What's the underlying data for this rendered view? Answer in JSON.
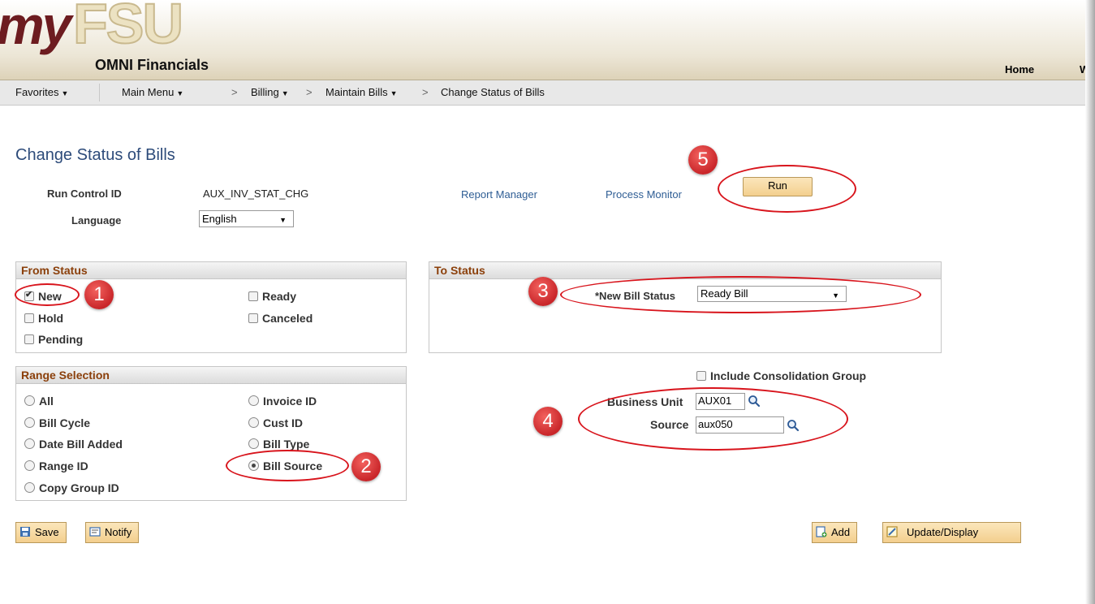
{
  "header": {
    "logo_my": "my",
    "logo_fsu": "FSU",
    "app_name": "OMNI Financials",
    "home": "Home",
    "w": "W"
  },
  "nav": {
    "favorites": "Favorites",
    "main_menu": "Main Menu",
    "billing": "Billing",
    "maintain_bills": "Maintain Bills",
    "current": "Change Status of Bills",
    "sep_symbol": ">"
  },
  "page": {
    "title": "Change Status of Bills",
    "run_control_label": "Run Control ID",
    "run_control_value": "AUX_INV_STAT_CHG",
    "language_label": "Language",
    "language_value": "English",
    "report_manager": "Report Manager",
    "process_monitor": "Process Monitor",
    "run_button": "Run"
  },
  "from_status": {
    "header": "From Status",
    "options": [
      {
        "label": "New",
        "checked": true
      },
      {
        "label": "Ready",
        "checked": false
      },
      {
        "label": "Hold",
        "checked": false
      },
      {
        "label": "Canceled",
        "checked": false
      },
      {
        "label": "Pending",
        "checked": false
      }
    ]
  },
  "to_status": {
    "header": "To Status",
    "new_bill_status_label": "*New Bill Status",
    "new_bill_status_value": "Ready Bill"
  },
  "range_selection": {
    "header": "Range Selection",
    "options": [
      {
        "label": "All",
        "selected": false
      },
      {
        "label": "Invoice ID",
        "selected": false
      },
      {
        "label": "Bill Cycle",
        "selected": false
      },
      {
        "label": "Cust ID",
        "selected": false
      },
      {
        "label": "Date Bill Added",
        "selected": false
      },
      {
        "label": "Bill Type",
        "selected": false
      },
      {
        "label": "Range ID",
        "selected": false
      },
      {
        "label": "Bill Source",
        "selected": true
      },
      {
        "label": "Copy Group ID",
        "selected": false
      }
    ]
  },
  "right_panel": {
    "include_consolidation": "Include Consolidation Group",
    "business_unit_label": "Business Unit",
    "business_unit_value": "AUX01",
    "source_label": "Source",
    "source_value": "aux050"
  },
  "toolbar": {
    "save": "Save",
    "notify": "Notify",
    "add": "Add",
    "update_display": "Update/Display"
  },
  "annotations": [
    "1",
    "2",
    "3",
    "4",
    "5"
  ],
  "colors": {
    "title_blue": "#2d4b7a",
    "group_header_text": "#8b3f0a",
    "annotation_red": "#d8141c",
    "button_fill": "#f3cf8e"
  }
}
